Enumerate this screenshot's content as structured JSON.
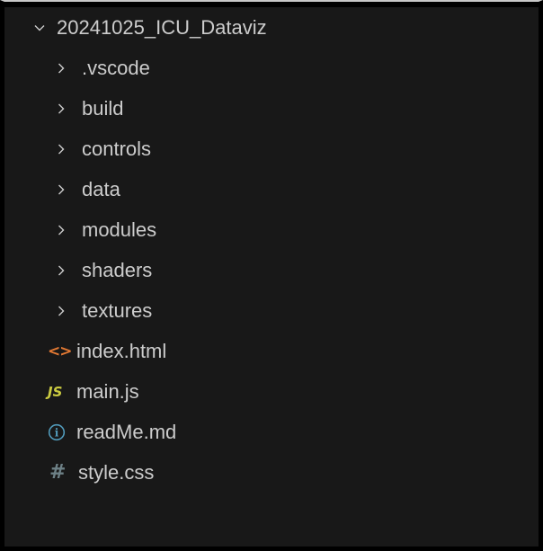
{
  "explorer": {
    "root": {
      "label": "20241025_ICU_Dataviz",
      "expanded": true
    },
    "folders": [
      {
        "label": ".vscode"
      },
      {
        "label": "build"
      },
      {
        "label": "controls"
      },
      {
        "label": "data"
      },
      {
        "label": "modules"
      },
      {
        "label": "shaders"
      },
      {
        "label": "textures"
      }
    ],
    "files": [
      {
        "label": "index.html",
        "icon": "html-icon",
        "glyph": "<>"
      },
      {
        "label": "main.js",
        "icon": "js-icon",
        "glyph": "JS"
      },
      {
        "label": "readMe.md",
        "icon": "info-icon",
        "glyph": "i"
      },
      {
        "label": "style.css",
        "icon": "hash-icon",
        "glyph": "#"
      }
    ]
  },
  "colors": {
    "background": "#181818",
    "text": "#cccccc",
    "html": "#e37933",
    "js": "#cbcb41",
    "info": "#519aba",
    "css": "#6d8086"
  }
}
